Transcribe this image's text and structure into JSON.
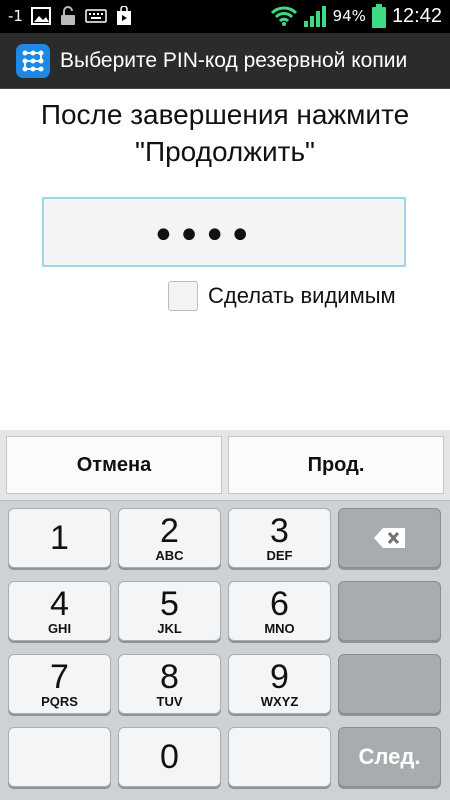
{
  "status_bar": {
    "signal_text": "-1",
    "battery_percent": "94%",
    "battery_level": 0.94,
    "time": "12:42",
    "icons": [
      "signal-minus-icon",
      "image-icon",
      "unlock-icon",
      "keyboard-icon",
      "play-store-icon",
      "wifi-icon",
      "cell-signal-icon",
      "battery-icon"
    ]
  },
  "title_bar": {
    "title": "Выберите PIN-код резервной копии",
    "icon": "pattern-lock-icon",
    "accent": "#1e88e5"
  },
  "instruction": {
    "line1": "После завершения нажмите",
    "line2": "\"Продолжить\""
  },
  "pin_input": {
    "value": "••••",
    "border_color": "#9fd6e6"
  },
  "show_checkbox": {
    "label": "Сделать видимым",
    "checked": false
  },
  "actions": {
    "cancel": "Отмена",
    "continue": "Прод."
  },
  "keypad": {
    "keys": [
      {
        "num": "1",
        "letters": ""
      },
      {
        "num": "2",
        "letters": "ABC"
      },
      {
        "num": "3",
        "letters": "DEF"
      },
      {
        "num": "4",
        "letters": "GHI"
      },
      {
        "num": "5",
        "letters": "JKL"
      },
      {
        "num": "6",
        "letters": "MNO"
      },
      {
        "num": "7",
        "letters": "PQRS"
      },
      {
        "num": "8",
        "letters": "TUV"
      },
      {
        "num": "9",
        "letters": "WXYZ"
      },
      {
        "num": "0",
        "letters": ""
      }
    ],
    "next_label": "След.",
    "backspace_icon": "backspace-icon"
  }
}
